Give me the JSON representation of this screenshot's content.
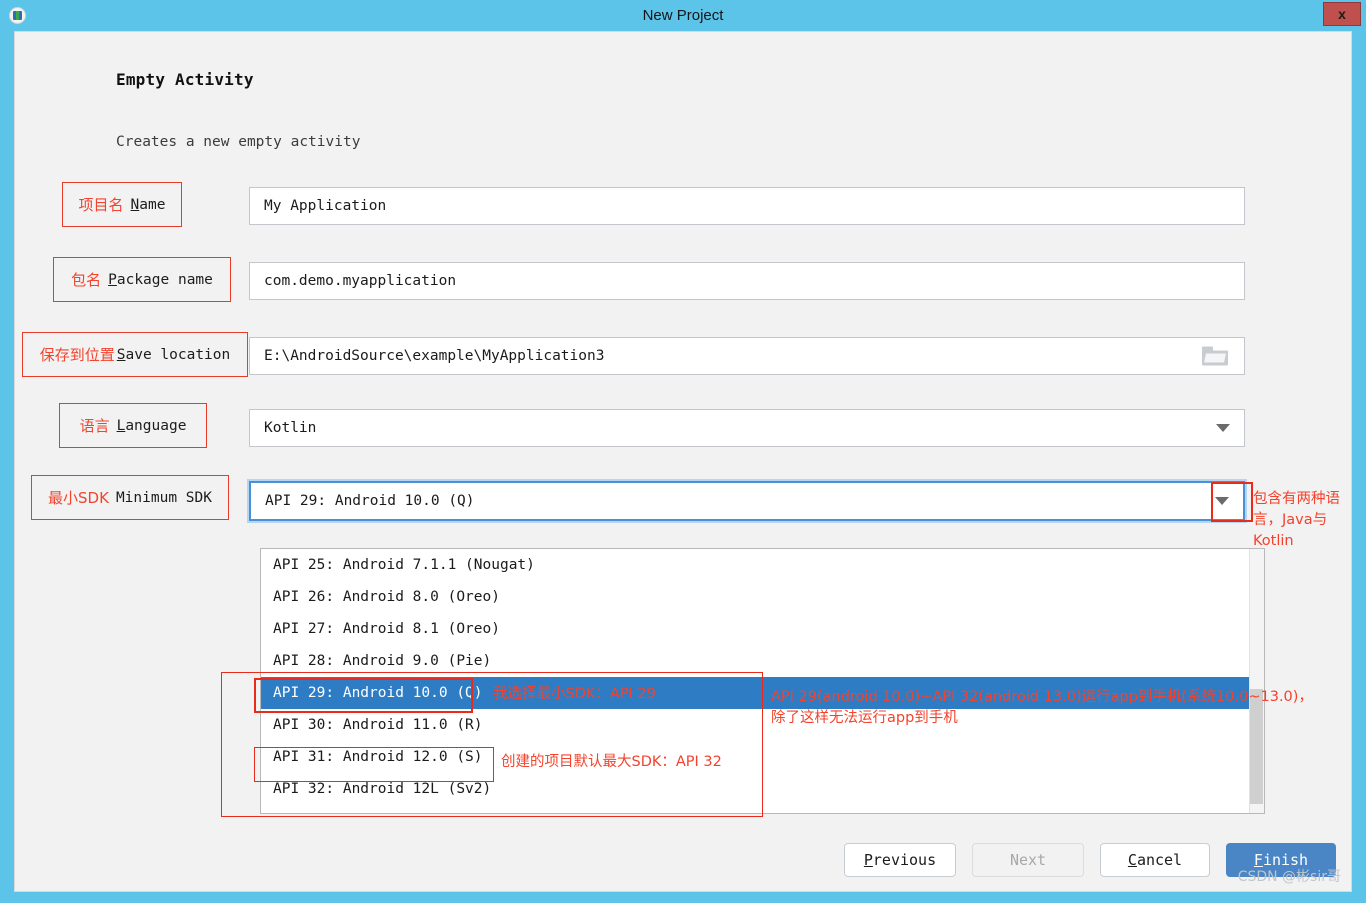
{
  "window": {
    "title": "New Project",
    "app_icon": "android-studio-icon",
    "close_label": "x"
  },
  "template": {
    "title": "Empty Activity",
    "description": "Creates a new empty activity"
  },
  "fields": [
    {
      "id": "name",
      "label_cn": "项目名",
      "label_en_mnemonic": "N",
      "label_en_rest": "ame",
      "value": "My Application",
      "type": "text"
    },
    {
      "id": "package-name",
      "label_cn": "包名",
      "label_en_mnemonic": "P",
      "label_en_rest": "ackage name",
      "value": "com.demo.myapplication",
      "type": "text"
    },
    {
      "id": "save-location",
      "label_cn": "保存到位置",
      "label_en_mnemonic": "S",
      "label_en_rest": "ave location",
      "value": "E:\\AndroidSource\\example\\MyApplication3",
      "type": "path",
      "icon": "folder-icon"
    },
    {
      "id": "language",
      "label_cn": "语言",
      "label_en_mnemonic": "L",
      "label_en_rest": "anguage",
      "value": "Kotlin",
      "type": "combo",
      "icon": "chevron-down-icon"
    },
    {
      "id": "minimum-sdk",
      "label_cn": "最小SDK",
      "label_en_mnemonic": "",
      "label_en_rest": "Minimum SDK",
      "value": "API 29: Android 10.0 (Q)",
      "type": "combo",
      "icon": "chevron-down-icon",
      "focused": true
    }
  ],
  "dropdown": {
    "open": true,
    "selected_index": 4,
    "items": [
      "API 25: Android 7.1.1 (Nougat)",
      "API 26: Android 8.0 (Oreo)",
      "API 27: Android 8.1 (Oreo)",
      "API 28: Android 9.0 (Pie)",
      "API 29: Android 10.0 (Q)",
      "API 30: Android 11.0 (R)",
      "API 31: Android 12.0 (S)",
      "API 32: Android 12L (Sv2)"
    ]
  },
  "annotations": {
    "language_note": "包含有两种语\n言，Java与\nKotlin",
    "selected_note": "我选择最小SDK：API 29",
    "max_sdk_note": "创建的项目默认最大SDK：API 32",
    "run_range_note": "API 29(android 10.0)~API 32(android 13.0)运行app到手机(系统10.0~13.0)，\n除了这样无法运行app到手机"
  },
  "footer": {
    "buttons": [
      {
        "id": "previous",
        "mnemonic": "P",
        "rest": "revious",
        "state": "normal"
      },
      {
        "id": "next",
        "mnemonic": "",
        "rest": "Next",
        "state": "disabled"
      },
      {
        "id": "cancel",
        "mnemonic": "C",
        "rest": "ancel",
        "state": "normal"
      },
      {
        "id": "finish",
        "mnemonic": "F",
        "rest": "inish",
        "state": "primary"
      }
    ]
  },
  "watermark": "CSDN @彬sir哥"
}
